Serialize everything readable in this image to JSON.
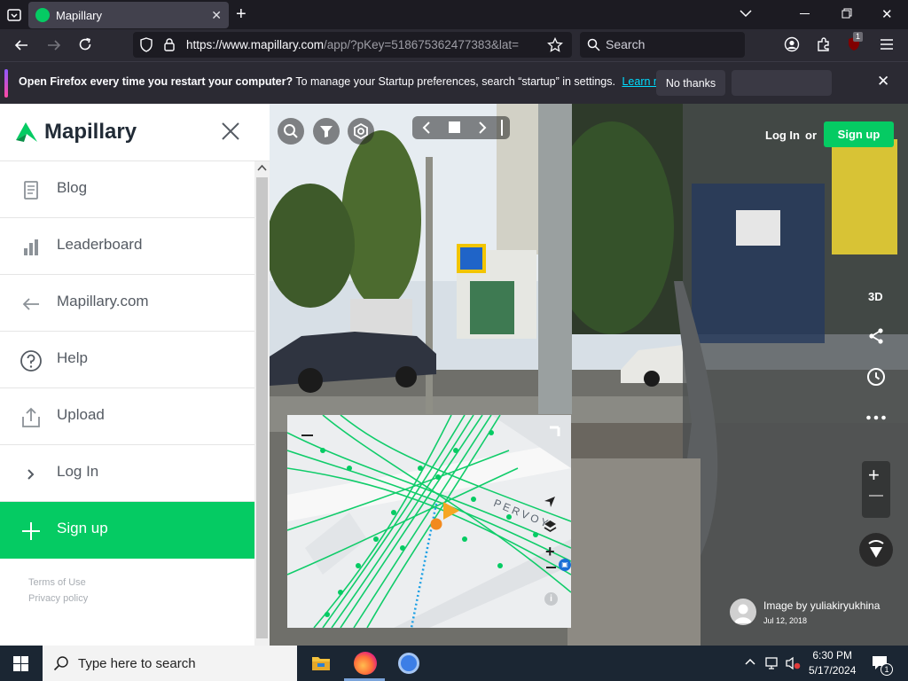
{
  "browser": {
    "tab_title": "Mapillary",
    "url_domain": "https://www.mapillary.com",
    "url_rest": "/app/?pKey=518675362477383&lat=",
    "search_placeholder": "Search",
    "extension_badge": "1"
  },
  "notification": {
    "bold": "Open Firefox every time you restart your computer?",
    "text": "To manage your Startup preferences, search “startup” in settings.",
    "link": "Learn more",
    "no_thanks": "No thanks"
  },
  "sidebar": {
    "brand": "Mapillary",
    "items": [
      {
        "label": "Blog",
        "icon": "blog-icon"
      },
      {
        "label": "Leaderboard",
        "icon": "leaderboard-icon"
      },
      {
        "label": "Mapillary.com",
        "icon": "arrow-left-icon"
      },
      {
        "label": "Help",
        "icon": "help-icon"
      },
      {
        "label": "Upload",
        "icon": "upload-icon"
      },
      {
        "label": "Log In",
        "icon": "chevron-right-icon"
      },
      {
        "label": "Sign up",
        "icon": "plus-icon"
      }
    ],
    "terms": "Terms of Use",
    "privacy": "Privacy policy"
  },
  "viewer": {
    "login": "Log In",
    "or": "or",
    "signup": "Sign up",
    "mode_3d": "3D",
    "image_by": "Image by yuliakiryukhina",
    "date": "Jul 12, 2018",
    "map_street": "PERVOY"
  },
  "taskbar": {
    "search_placeholder": "Type here to search",
    "time": "6:30 PM",
    "date": "5/17/2024",
    "notif_count": "1"
  },
  "colors": {
    "brand_green": "#05cb63",
    "map_blue": "#1a9fe5",
    "map_orange": "#f5a623"
  }
}
